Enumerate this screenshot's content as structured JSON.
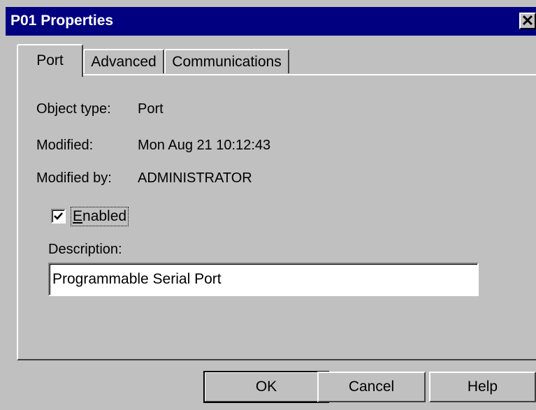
{
  "window": {
    "title": "P01 Properties",
    "close_glyph": "✕",
    "close_icon": "close-icon"
  },
  "tabs": [
    {
      "label": "Port",
      "active": true
    },
    {
      "label": "Advanced",
      "active": false
    },
    {
      "label": "Communications",
      "active": false
    }
  ],
  "details": {
    "object_type_label": "Object type:",
    "object_type_value": "Port",
    "modified_label": "Modified:",
    "modified_value": "Mon Aug 21 10:12:43",
    "modified_by_label": "Modified by:",
    "modified_by_value": "ADMINISTRATOR"
  },
  "enabled": {
    "label_first": "E",
    "label_rest": "nabled",
    "checked": true
  },
  "description": {
    "label": "Description:",
    "value": "Programmable Serial Port"
  },
  "buttons": {
    "ok": "OK",
    "cancel": "Cancel",
    "help": "Help"
  },
  "colors": {
    "titlebar": "#000080",
    "face": "#c0c0c0",
    "title_text": "#ffffff"
  }
}
